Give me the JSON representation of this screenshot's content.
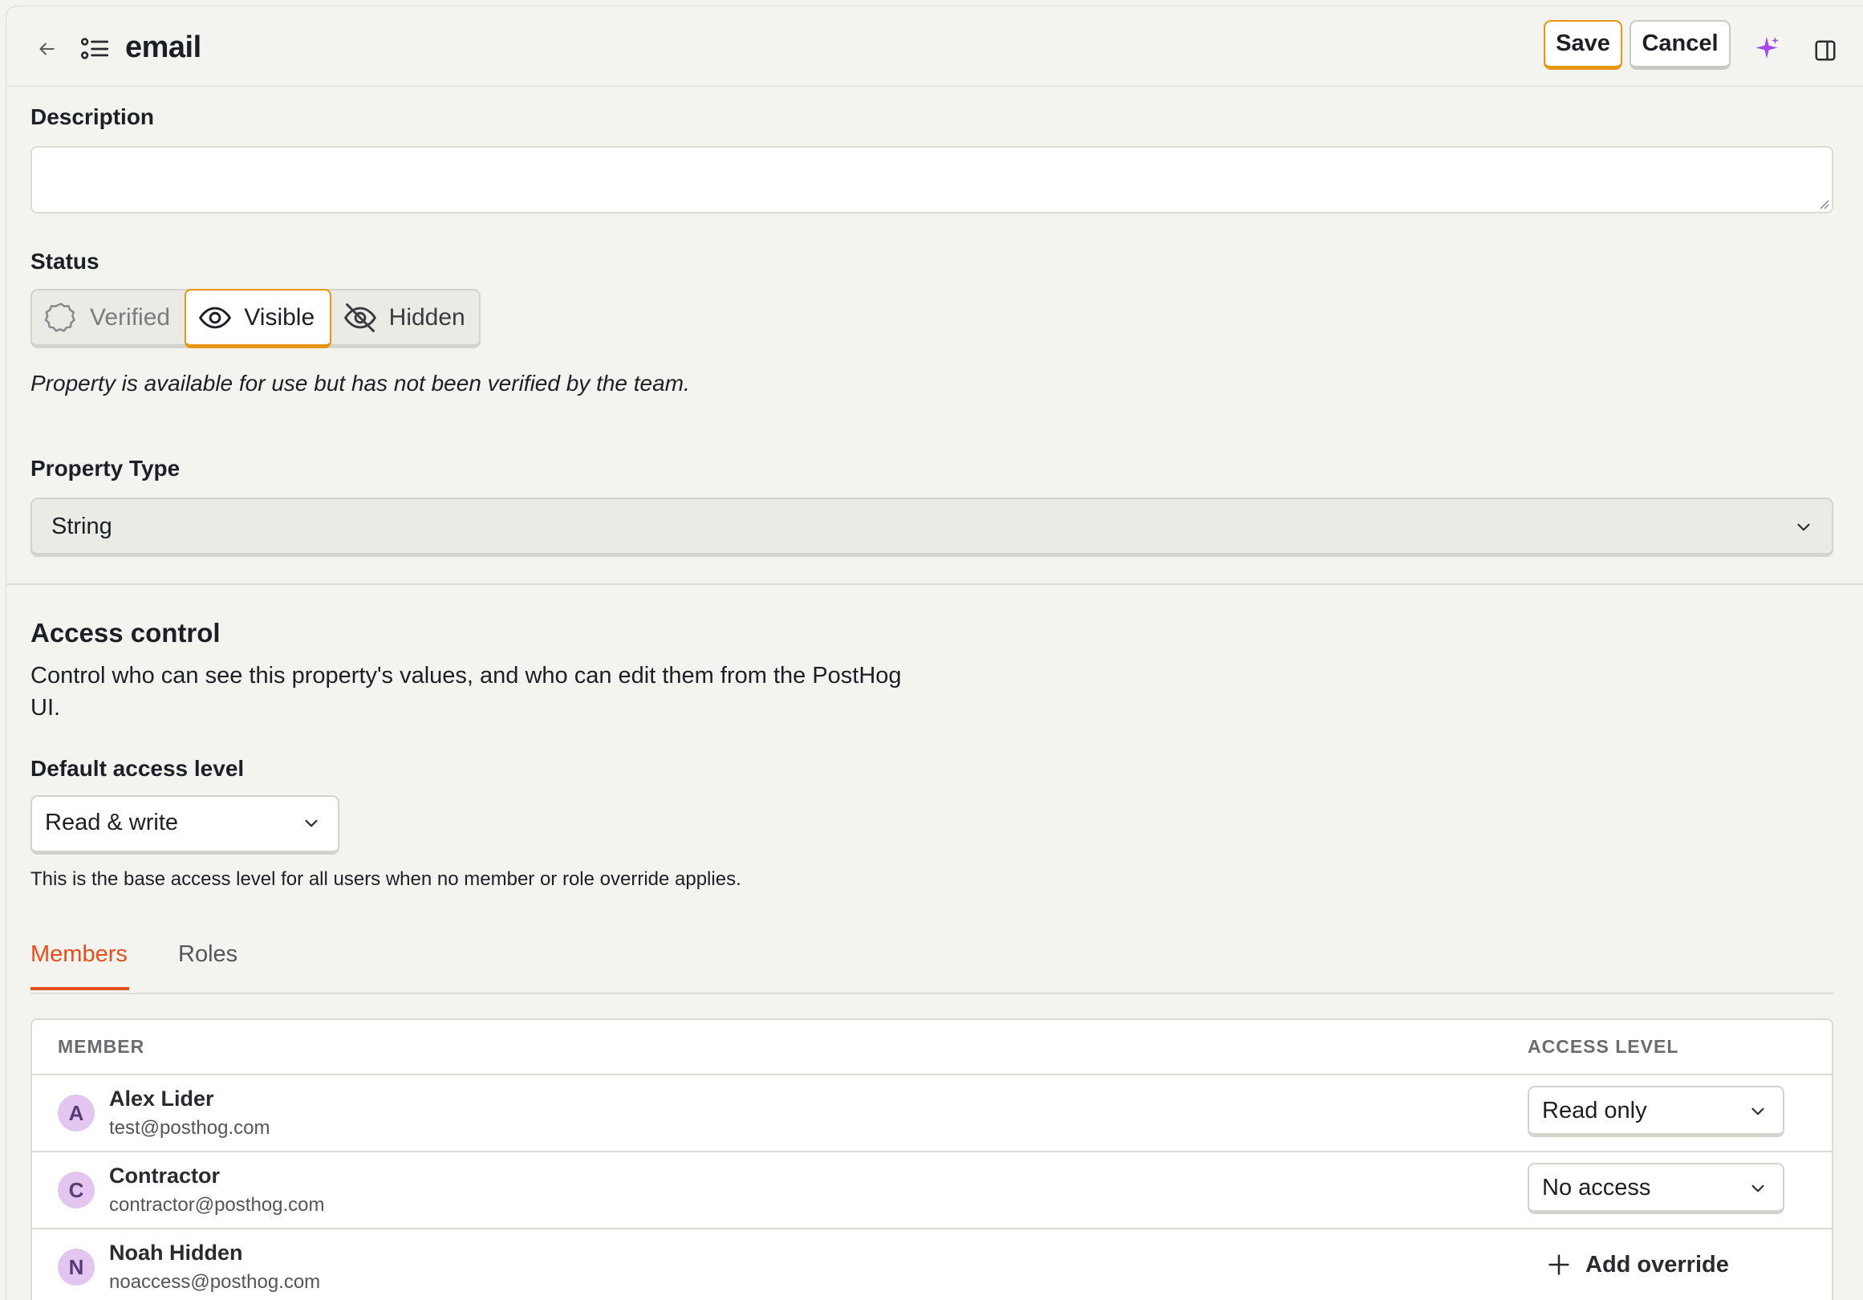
{
  "header": {
    "title": "email",
    "save_label": "Save",
    "cancel_label": "Cancel",
    "icons": [
      "arrow-left-icon",
      "list-icon",
      "sparkle-icon",
      "side-panel-icon"
    ],
    "accent_color": "#e59612",
    "sparkle_color": "#a149ea"
  },
  "description": {
    "label": "Description",
    "value": "",
    "placeholder": ""
  },
  "status": {
    "label": "Status",
    "options": [
      {
        "label": "Verified",
        "icon": "verified-badge-icon",
        "selected": false
      },
      {
        "label": "Visible",
        "icon": "eye-icon",
        "selected": true
      },
      {
        "label": "Hidden",
        "icon": "eye-off-icon",
        "selected": false
      }
    ],
    "help_text": "Property is available for use but has not been verified by the team."
  },
  "property_type": {
    "label": "Property Type",
    "value": "String"
  },
  "access_control": {
    "title": "Access control",
    "description": "Control who can see this property's values, and who can edit them from the PostHog UI.",
    "default_label": "Default access level",
    "default_value": "Read & write",
    "default_help": "This is the base access level for all users when no member or role override applies.",
    "tabs": [
      {
        "label": "Members",
        "active": true
      },
      {
        "label": "Roles",
        "active": false
      }
    ],
    "active_tab_color": "#e3501d",
    "table": {
      "columns": [
        "MEMBER",
        "ACCESS LEVEL"
      ],
      "rows": [
        {
          "initial": "A",
          "name": "Alex Lider",
          "email": "test@posthog.com",
          "access": "Read only"
        },
        {
          "initial": "C",
          "name": "Contractor",
          "email": "contractor@posthog.com",
          "access": "No access"
        },
        {
          "initial": "N",
          "name": "Noah Hidden",
          "email": "noaccess@posthog.com",
          "access": null,
          "action": "Add override"
        }
      ]
    }
  }
}
